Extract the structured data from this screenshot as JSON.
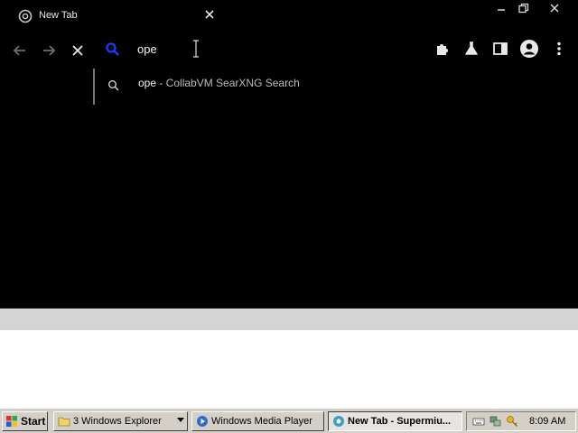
{
  "browser": {
    "tab": {
      "title": "New Tab"
    },
    "omnibox": {
      "value": "ope"
    },
    "suggestion": {
      "query": "ope",
      "separator": " - ",
      "engine": "CollabVM SearXNG Search"
    },
    "colors": {
      "background": "#000000",
      "search_accent": "#1a3cff"
    }
  },
  "taskbar": {
    "start_label": "Start",
    "buttons": [
      {
        "label": "3 Windows Explorer",
        "icon": "folder-icon"
      },
      {
        "label": "Windows Media Player",
        "icon": "media-player-icon"
      },
      {
        "label": "New Tab - Supermiu...",
        "icon": "browser-icon",
        "active": true
      }
    ],
    "clock": "8:09 AM",
    "colors": {
      "face": "#d4d0c8"
    }
  }
}
